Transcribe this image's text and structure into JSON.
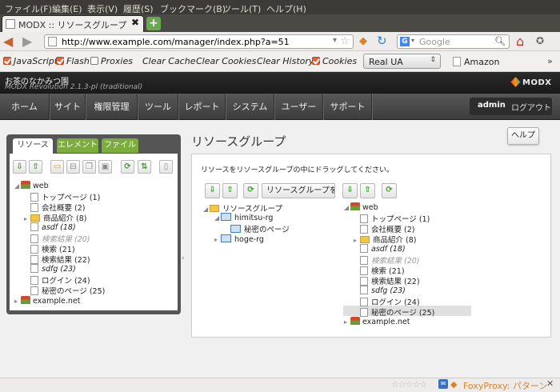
{
  "menubar": [
    "ファイル(F)",
    "編集(E)",
    "表示(V)",
    "履歴(S)",
    "ブックマーク(B)",
    "ツール(T)",
    "ヘルプ(H)"
  ],
  "tab": {
    "title": "MODX :: リソースグループ"
  },
  "address": {
    "url": "http://www.example.com/manager/index.php?a=51"
  },
  "search": {
    "engine": "G",
    "placeholder": "Google"
  },
  "devbar": {
    "javascript": "JavaScript",
    "flash": "Flash",
    "proxies": "Proxies",
    "clear_cache": "Clear Cache",
    "clear_cookies": "Clear Cookies",
    "clear_history": "Clear History",
    "cookies": "Cookies",
    "ua": "Real UA",
    "amazon": "Amazon",
    "more": "»"
  },
  "modx": {
    "site_name": "お茶のなかみつ園",
    "version": "MODX Revolution 2.1.3-pl (traditional)",
    "logo": "MODX"
  },
  "nav": [
    "ホーム",
    "サイト",
    "権限管理",
    "ツール",
    "レポート",
    "システム",
    "ユーザー",
    "サポート"
  ],
  "user": {
    "name": "admin",
    "logout": "ログアウト"
  },
  "left_tabs": [
    "リソース",
    "エレメント",
    "ファイル"
  ],
  "page": {
    "title": "リソースグループ",
    "help": "ヘルプ",
    "instructions": "リソースをリソースグループの中にドラッグしてください。",
    "assign_button": "リソースグループを作成"
  },
  "left_tree": {
    "root": "web",
    "items": [
      "トップページ (1)",
      "会社概要 (2)",
      "商品紹介 (8)",
      "asdf (18)",
      "検索結果 (20)",
      "検索 (21)",
      "検索結果 (22)",
      "sdfg (23)",
      "ログイン (24)",
      "秘密のページ (25)"
    ],
    "root2": "example.net"
  },
  "group_tree": {
    "root": "リソースグループ",
    "g1": "himitsu-rg",
    "g1_child": "秘密のページ",
    "g2": "hoge-rg"
  },
  "right_tree": {
    "root": "web",
    "items": [
      "トップページ (1)",
      "会社概要 (2)",
      "商品紹介 (8)",
      "asdf (18)",
      "検索結果 (20)",
      "検索 (21)",
      "検索結果 (22)",
      "sdfg (23)",
      "ログイン (24)",
      "秘密のページ (25)"
    ],
    "root2": "example.net"
  },
  "statusbar": {
    "foxyproxy": "FoxyProxy: パターン",
    "close": "✕"
  }
}
